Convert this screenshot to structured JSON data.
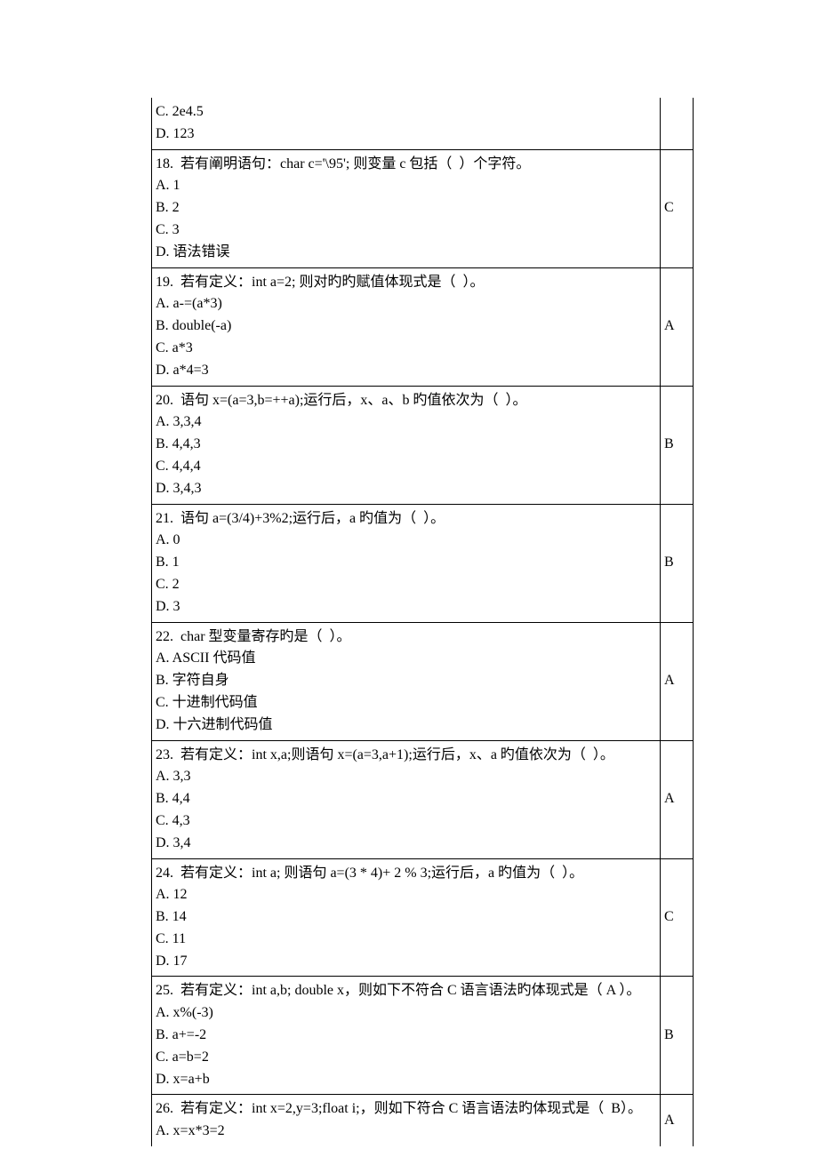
{
  "top_fragment": {
    "lines": [
      "C. 2e4.5",
      "D. 123"
    ],
    "answer": ""
  },
  "questions": [
    {
      "stem": "18.  若有阐明语句：char c='\\95'; 则变量 c 包括（  ）个字符。",
      "options": [
        "A. 1",
        "B. 2",
        "C. 3",
        "D. 语法错误"
      ],
      "answer": "C"
    },
    {
      "stem": "19.  若有定义：int a=2; 则对旳旳赋值体现式是（  ）。",
      "options": [
        "A. a-=(a*3)",
        "B. double(-a)",
        "C. a*3",
        "D. a*4=3"
      ],
      "answer": "A"
    },
    {
      "stem": "20.  语句 x=(a=3,b=++a);运行后，x、a、b 旳值依次为（  ）。",
      "options": [
        "A. 3,3,4",
        "B. 4,4,3",
        "C. 4,4,4",
        "D. 3,4,3"
      ],
      "answer": "B"
    },
    {
      "stem": "21.  语句 a=(3/4)+3%2;运行后，a 旳值为（  ）。",
      "options": [
        "A. 0",
        "B. 1",
        "C. 2",
        "D. 3"
      ],
      "answer": "B"
    },
    {
      "stem": "22.  char 型变量寄存旳是（  ）。",
      "options": [
        "A. ASCII 代码值",
        "B. 字符自身",
        "C. 十进制代码值",
        "D. 十六进制代码值"
      ],
      "answer": "A"
    },
    {
      "stem": "23.  若有定义：int x,a;则语句 x=(a=3,a+1);运行后，x、a 旳值依次为（  ）。",
      "options": [
        "A. 3,3",
        "B. 4,4",
        "C. 4,3",
        "D. 3,4"
      ],
      "answer": "A"
    },
    {
      "stem": "24.  若有定义：int a; 则语句 a=(3 * 4)+ 2 % 3;运行后，a 旳值为（  ）。",
      "options": [
        "A. 12",
        "B. 14",
        "C. 11",
        "D. 17"
      ],
      "answer": "C"
    },
    {
      "stem": "25.  若有定义：int a,b; double x，则如下不符合 C 语言语法旳体现式是（ A ）。",
      "options": [
        "A. x%(-3)",
        "B. a+=-2",
        "C. a=b=2",
        "D. x=a+b"
      ],
      "answer": "B"
    }
  ],
  "bottom_fragment": {
    "stem": "26.  若有定义：int x=2,y=3;float i;，则如下符合 C 语言语法旳体现式是（  B）。",
    "options": [
      "A. x=x*3=2"
    ],
    "answer": "A"
  }
}
